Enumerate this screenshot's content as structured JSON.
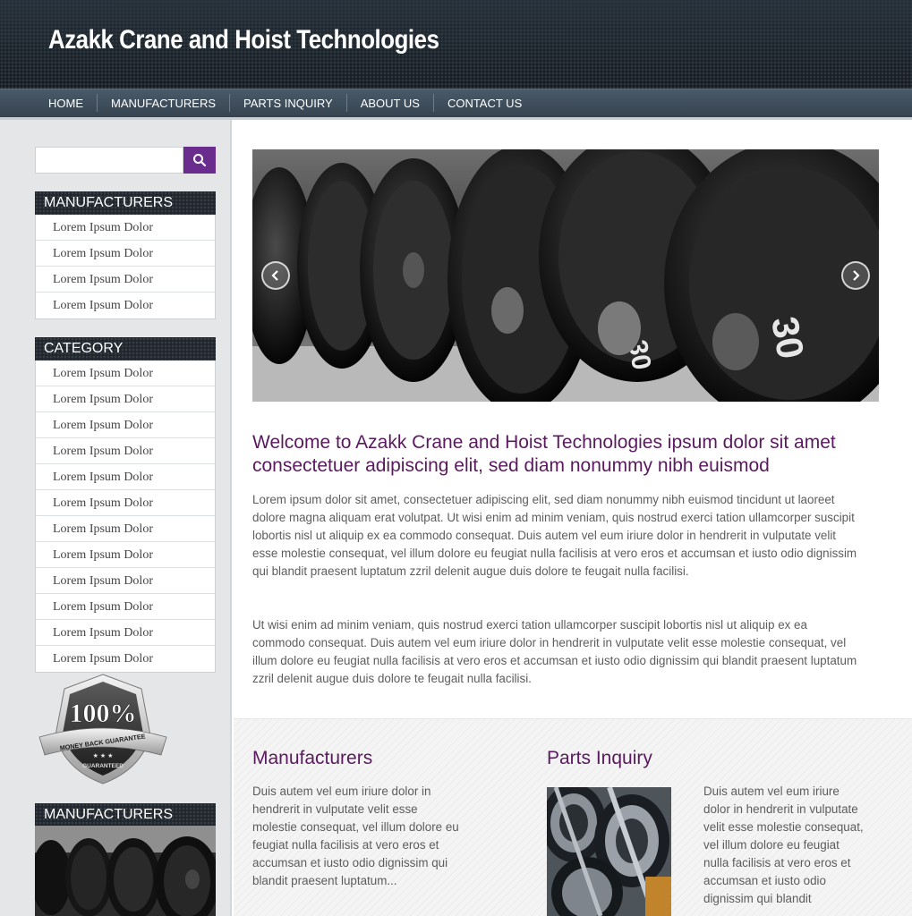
{
  "header": {
    "title": "Azakk Crane and Hoist Technologies"
  },
  "nav": {
    "items": [
      "HOME",
      "MANUFACTURERS",
      "PARTS INQUIRY",
      "ABOUT US",
      "CONTACT US"
    ]
  },
  "sidebar": {
    "search": {
      "placeholder": "",
      "button_icon": "search-icon"
    },
    "manufacturers": {
      "title": "MANUFACTURERS",
      "items": [
        "Lorem Ipsum Dolor",
        "Lorem Ipsum Dolor",
        "Lorem Ipsum Dolor",
        "Lorem Ipsum Dolor"
      ]
    },
    "category": {
      "title": "CATEGORY",
      "items": [
        "Lorem Ipsum Dolor",
        "Lorem Ipsum Dolor",
        "Lorem Ipsum Dolor",
        "Lorem Ipsum Dolor",
        "Lorem Ipsum Dolor",
        "Lorem Ipsum Dolor",
        "Lorem Ipsum Dolor",
        "Lorem Ipsum Dolor",
        "Lorem Ipsum Dolor",
        "Lorem Ipsum Dolor",
        "Lorem Ipsum Dolor",
        "Lorem Ipsum Dolor"
      ]
    },
    "badge": {
      "percent": "100%",
      "line1": "MONEY BACK GUARANTEE",
      "line2": "GUARANTEED"
    },
    "manufacturers2": {
      "title": "MANUFACTURERS"
    }
  },
  "main": {
    "welcome_title": "Welcome to Azakk Crane and Hoist Technologies ipsum dolor sit amet consectetuer adipiscing elit, sed diam nonummy nibh euismod",
    "para1": "Lorem ipsum dolor sit amet, consectetuer adipiscing elit, sed diam nonummy nibh euismod tincidunt ut laoreet dolore magna aliquam erat volutpat. Ut wisi enim ad minim veniam, quis nostrud exerci tation ullamcorper suscipit lobortis nisl ut aliquip ex ea commodo consequat. Duis autem vel eum iriure dolor in hendrerit in vulputate velit esse molestie consequat, vel illum dolore eu feugiat nulla facilisis at vero eros et accumsan et iusto odio dignissim qui blandit praesent luptatum zzril delenit augue duis dolore te feugait nulla facilisi.",
    "para2": "Ut wisi enim ad minim veniam, quis nostrud exerci tation ullamcorper suscipit lobortis nisl ut aliquip ex ea commodo consequat. Duis autem vel eum iriure dolor in hendrerit in vulputate velit esse molestie consequat, vel illum dolore eu feugiat nulla facilisis at vero eros et accumsan et iusto odio dignissim qui blandit praesent luptatum zzril delenit augue duis dolore te feugait nulla facilisi.",
    "manufacturers": {
      "title": "Manufacturers",
      "text": "Duis autem vel eum iriure dolor in hendrerit in vulputate velit esse molestie consequat, vel illum dolore eu feugiat nulla facilisis at vero eros et accumsan et iusto odio dignissim qui blandit praesent luptatum..."
    },
    "parts": {
      "title": "Parts Inquiry",
      "text": "Duis autem vel eum iriure dolor in hendrerit in vulputate velit esse molestie consequat, vel illum dolore eu feugiat nulla facilisis at vero eros et accumsan et iusto odio dignissim qui blandit"
    }
  },
  "colors": {
    "accent": "#6a2d8e",
    "heading": "#5a1a5e",
    "nav": "#3e4c59",
    "header": "#1e252c"
  }
}
